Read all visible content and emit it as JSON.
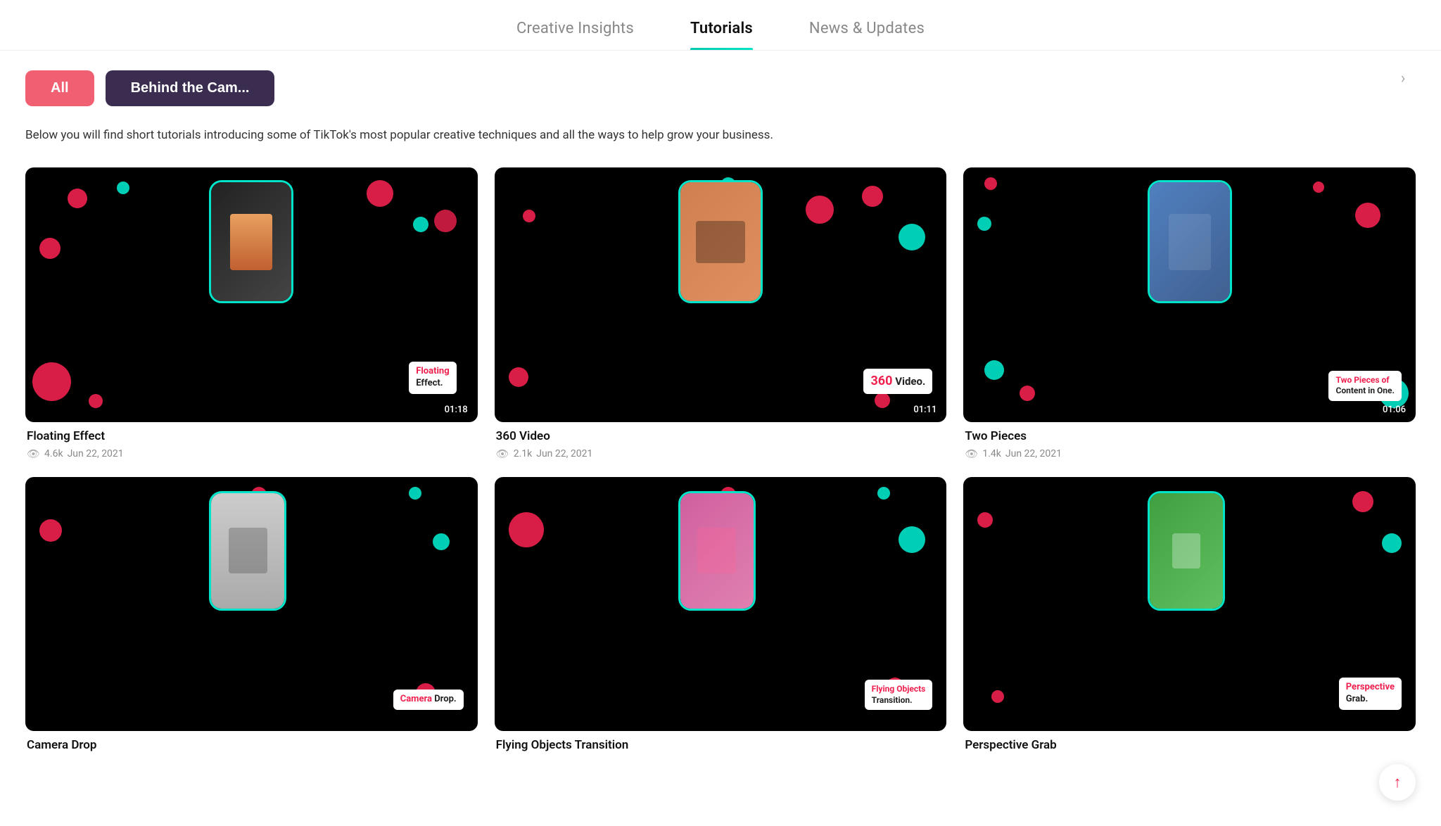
{
  "nav": {
    "tabs": [
      {
        "id": "creative-insights",
        "label": "Creative Insights",
        "active": false
      },
      {
        "id": "tutorials",
        "label": "Tutorials",
        "active": true
      },
      {
        "id": "news-updates",
        "label": "News & Updates",
        "active": false
      }
    ]
  },
  "filters": {
    "chips": [
      {
        "id": "all",
        "label": "All",
        "active": true
      },
      {
        "id": "behind-the-cam",
        "label": "Behind the Cam...",
        "active": false
      }
    ],
    "arrow_label": "›"
  },
  "description": "Below you will find short tutorials introducing some of TikTok's most popular creative techniques and all the ways to help grow your business.",
  "videos": [
    {
      "id": "floating-effect",
      "title": "Floating Effect",
      "label_pink": "Floating",
      "label_black": "Effect.",
      "duration": "01:18",
      "views": "4.6k",
      "date": "Jun 22, 2021"
    },
    {
      "id": "360-video",
      "title": "360 Video",
      "label_pink": "360",
      "label_black": "Video.",
      "duration": "01:11",
      "views": "2.1k",
      "date": "Jun 22, 2021"
    },
    {
      "id": "two-pieces",
      "title": "Two Pieces",
      "label_pink": "Two Pieces of",
      "label_black": "Content in One.",
      "duration": "01:06",
      "views": "1.4k",
      "date": "Jun 22, 2021"
    },
    {
      "id": "camera-drop",
      "title": "Camera Drop",
      "label_pink": "Camera",
      "label_black": "Drop.",
      "duration": "",
      "views": "",
      "date": ""
    },
    {
      "id": "flying-objects",
      "title": "Flying Objects Transition",
      "label_pink": "Flying Objects",
      "label_black": "Transition.",
      "duration": "",
      "views": "",
      "date": ""
    },
    {
      "id": "perspective-grab",
      "title": "Perspective Grab",
      "label_pink": "Perspective",
      "label_black": "Grab.",
      "duration": "",
      "views": "",
      "date": ""
    }
  ],
  "scroll_top_icon": "↑"
}
